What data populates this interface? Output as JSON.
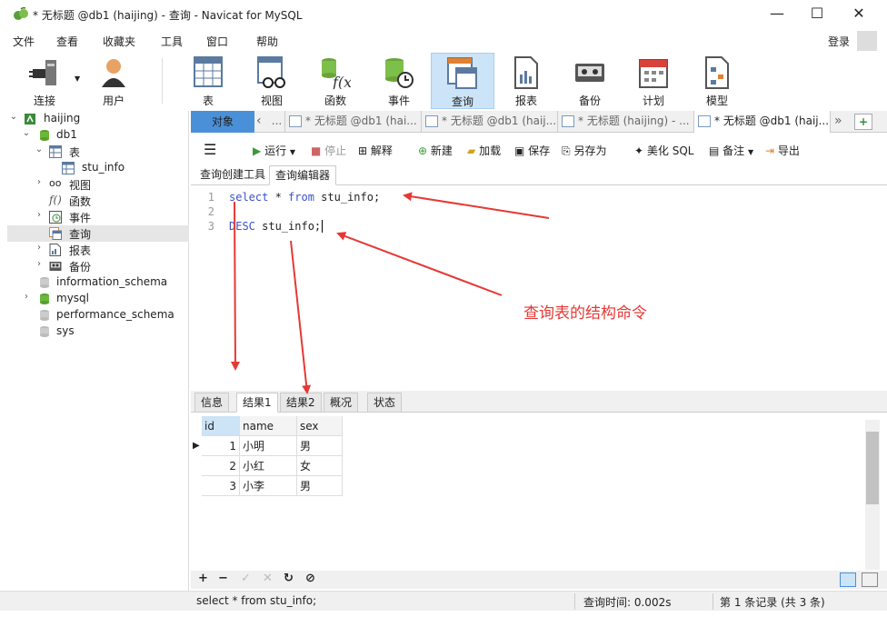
{
  "window": {
    "title": "* 无标题 @db1 (haijing) - 查询 - Navicat for MySQL",
    "minimize": "—",
    "maximize": "☐",
    "close": "✕"
  },
  "menu": [
    "文件",
    "查看",
    "收藏夹",
    "工具",
    "窗口",
    "帮助"
  ],
  "login": "登录",
  "toolbar": [
    {
      "label": "连接",
      "icon": "plug-icon"
    },
    {
      "label": "用户",
      "icon": "user-icon"
    },
    {
      "label": "表",
      "icon": "table-icon"
    },
    {
      "label": "视图",
      "icon": "view-icon"
    },
    {
      "label": "函数",
      "icon": "function-icon"
    },
    {
      "label": "事件",
      "icon": "event-icon"
    },
    {
      "label": "查询",
      "icon": "query-icon"
    },
    {
      "label": "报表",
      "icon": "report-icon"
    },
    {
      "label": "备份",
      "icon": "backup-icon"
    },
    {
      "label": "计划",
      "icon": "schedule-icon"
    },
    {
      "label": "模型",
      "icon": "model-icon"
    }
  ],
  "sidebar": {
    "connection": "haijing",
    "db": "db1",
    "tables_label": "表",
    "table": "stu_info",
    "views": "视图",
    "functions": "函数",
    "events": "事件",
    "queries": "查询",
    "reports": "报表",
    "backups": "备份",
    "other_dbs": [
      "information_schema",
      "mysql",
      "performance_schema",
      "sys"
    ]
  },
  "tabs": {
    "objects": "对象",
    "items": [
      "* 无标题 @db1 (hai...",
      "* 无标题 @db1 (haij...",
      "* 无标题 (haijing) - ...",
      "* 无标题 @db1 (haij..."
    ]
  },
  "editor_toolbar": {
    "run": "运行",
    "stop": "停止",
    "explain": "解释",
    "new": "新建",
    "load": "加载",
    "save": "保存",
    "save_as": "另存为",
    "beautify": "美化 SQL",
    "comment": "备注",
    "export": "导出"
  },
  "subtabs": [
    "查询创建工具",
    "查询编辑器"
  ],
  "code": {
    "line_numbers": [
      "1",
      "2",
      "3"
    ],
    "line1_kw1": "select",
    "line1_mid": " * ",
    "line1_kw2": "from",
    "line1_rest": " stu_info;",
    "line3_kw": "DESC",
    "line3_rest": " stu_info;"
  },
  "annotation": "查询表的结构命令",
  "result_tabs": [
    "信息",
    "结果1",
    "结果2",
    "概况",
    "状态"
  ],
  "grid": {
    "columns": [
      "id",
      "name",
      "sex"
    ],
    "rows": [
      [
        "1",
        "小明",
        "男"
      ],
      [
        "2",
        "小红",
        "女"
      ],
      [
        "3",
        "小李",
        "男"
      ]
    ]
  },
  "status": {
    "sql": "select * from stu_info;",
    "time": "查询时间: 0.002s",
    "records": "第 1 条记录 (共 3 条)"
  },
  "colors": {
    "keyword": "#3a50c8",
    "annotation": "#e53935",
    "accent": "#4a90d9"
  }
}
